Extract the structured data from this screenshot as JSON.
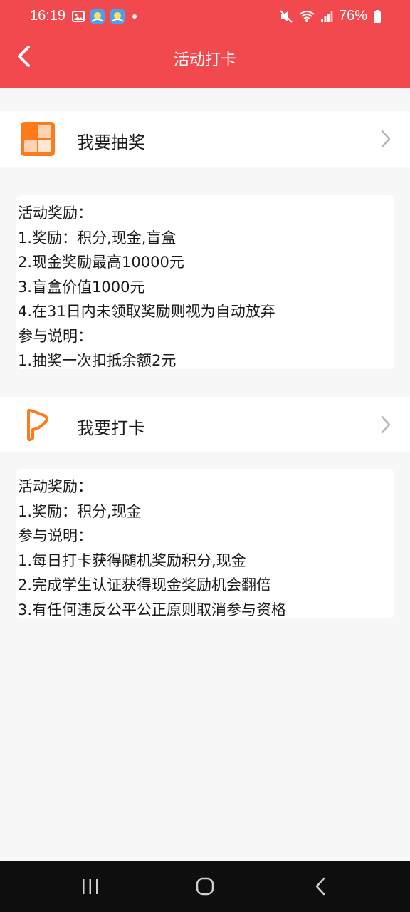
{
  "status_bar": {
    "time": "16:19",
    "battery": "76%"
  },
  "header": {
    "title": "活动打卡"
  },
  "lottery": {
    "label": "我要抽奖",
    "lines": [
      "活动奖励：",
      "1.奖励：积分,现金,盲盒",
      "2.现金奖励最高10000元",
      "3.盲盒价值1000元",
      "4.在31日内未领取奖励则视为自动放弃",
      "参与说明：",
      "1.抽奖一次扣抵余额2元"
    ]
  },
  "checkin": {
    "label": "我要打卡",
    "lines": [
      "活动奖励：",
      "1.奖励：积分,现金",
      "参与说明：",
      "1.每日打卡获得随机奖励积分,现金",
      "2.完成学生认证获得现金奖励机会翻倍",
      "3.有任何违反公平公正原则取消参与资格"
    ]
  },
  "colors": {
    "header_bg": "#f2494e",
    "accent_orange": "#ff7a1a",
    "page_bg": "#f7f7f7"
  },
  "icons": {
    "back": "chevron-left-icon",
    "lottery": "lottery-grid-icon",
    "checkin": "flag-icon",
    "row_arrow": "chevron-right-icon"
  }
}
